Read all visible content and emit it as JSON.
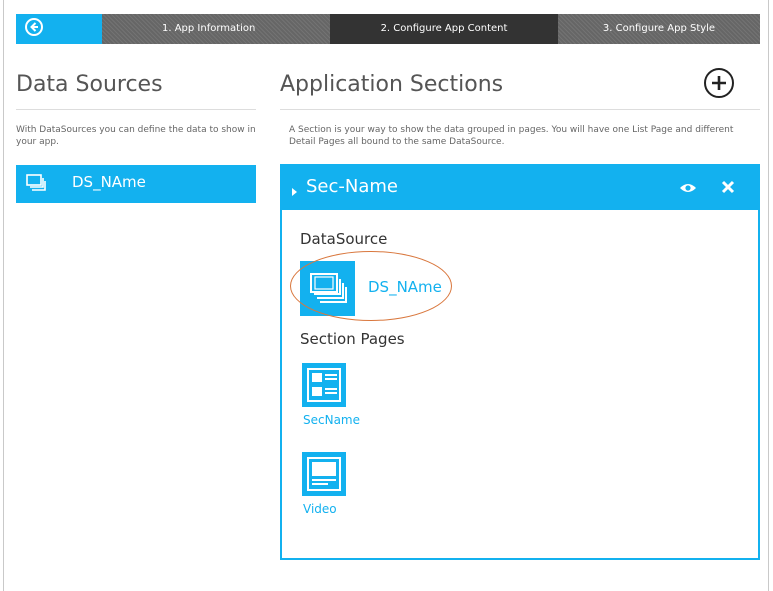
{
  "nav": {
    "steps": [
      {
        "label": "1. App Information"
      },
      {
        "label": "2. Configure App Content"
      },
      {
        "label": "3. Configure App Style"
      }
    ]
  },
  "data_sources": {
    "title": "Data Sources",
    "description": "With DataSources you can define the data to show in your app.",
    "items": [
      {
        "label": "DS_NAme"
      }
    ]
  },
  "app_sections": {
    "title": "Application Sections",
    "description": "A Section is your way to show the data grouped in pages. You will have one List Page and different Detail Pages all bound to the same DataSource.",
    "section": {
      "name": "Sec-Name",
      "datasource_heading": "DataSource",
      "datasource_name": "DS_NAme",
      "pages_heading": "Section Pages",
      "pages": [
        {
          "label": "SecName"
        },
        {
          "label": "Video"
        }
      ]
    }
  },
  "colors": {
    "accent": "#13b1ef",
    "active_step": "#333333",
    "inactive_step": "#6b6b6b",
    "highlight_ring": "#d9773d"
  }
}
